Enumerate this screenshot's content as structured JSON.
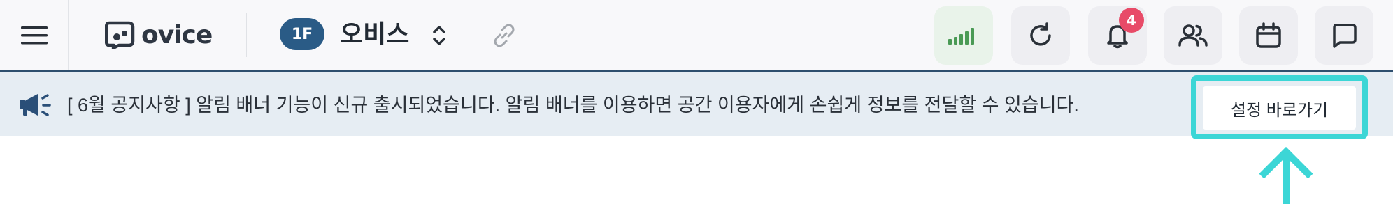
{
  "header": {
    "logo_text": "ovice",
    "floor_label": "1F",
    "space_name": "오비스",
    "notification_count": "4",
    "icons": {
      "menu": "hamburger-menu-icon",
      "logo": "ovice-logo-icon",
      "switch": "chevron-up-down-icon",
      "link": "link-icon",
      "signal": "signal-strength-icon",
      "refresh": "refresh-icon",
      "notifications": "bell-icon",
      "members": "users-icon",
      "calendar": "calendar-icon",
      "chat": "chat-bubble-icon"
    }
  },
  "banner": {
    "message": "[ 6월 공지사항 ] 알림 배너 기능이 신규 출시되었습니다. 알림 배너를 이용하면 공간 이용자에게 손쉽게 정보를 전달할 수 있습니다.",
    "cta_label": "설정 바로가기",
    "icon": "megaphone-icon"
  },
  "colors": {
    "accent": "#2a5b86",
    "highlight": "#3cd6d6",
    "badge": "#e84b68",
    "signal": "#4a9a55",
    "banner_bg": "#e6edf3"
  }
}
